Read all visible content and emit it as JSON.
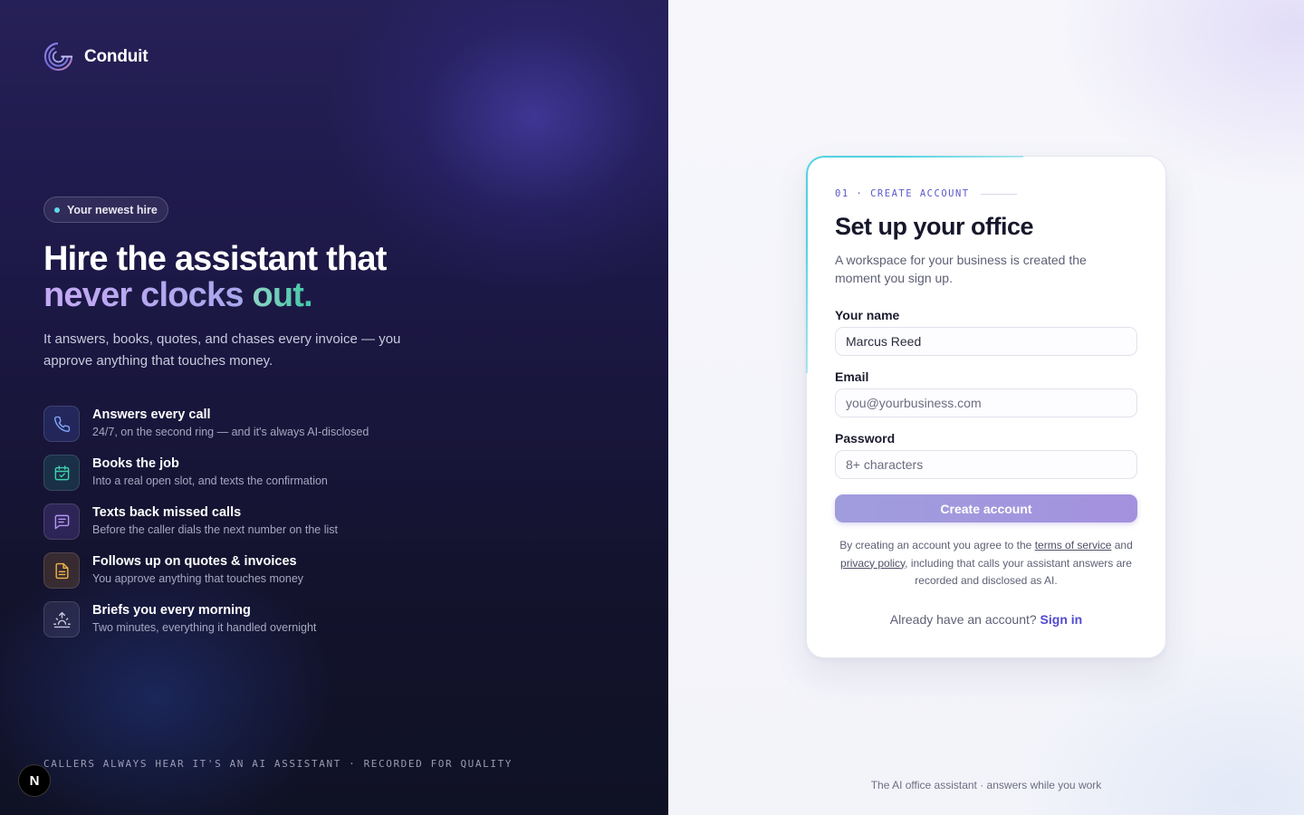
{
  "brand": {
    "name": "Conduit",
    "logo_icon": "conduit-logo-icon"
  },
  "hero": {
    "pill": "Your newest hire",
    "headline_line1": "Hire the assistant that",
    "headline_part_a": "never clocks",
    "headline_part_b": "out.",
    "subtitle": "It answers, books, quotes, and chases every invoice — you approve anything that touches money."
  },
  "features": [
    {
      "icon": "phone-icon",
      "title": "Answers every call",
      "desc": "24/7, on the second ring — and it's always AI-disclosed"
    },
    {
      "icon": "calendar-check-icon",
      "title": "Books the job",
      "desc": "Into a real open slot, and texts the confirmation"
    },
    {
      "icon": "message-icon",
      "title": "Texts back missed calls",
      "desc": "Before the caller dials the next number on the list"
    },
    {
      "icon": "document-icon",
      "title": "Follows up on quotes & invoices",
      "desc": "You approve anything that touches money"
    },
    {
      "icon": "sunrise-icon",
      "title": "Briefs you every morning",
      "desc": "Two minutes, everything it handled overnight"
    }
  ],
  "footnote": "CALLERS ALWAYS HEAR IT'S AN AI ASSISTANT · RECORDED FOR QUALITY",
  "badge": "N",
  "form": {
    "step": "01 · CREATE ACCOUNT",
    "title": "Set up your office",
    "subtitle": "A workspace for your business is created the moment you sign up.",
    "name_label": "Your name",
    "name_value": "Marcus Reed",
    "email_label": "Email",
    "email_placeholder": "you@yourbusiness.com",
    "password_label": "Password",
    "password_placeholder": "8+ characters",
    "submit": "Create account",
    "legal_prefix": "By creating an account you agree to the",
    "terms_link": "terms of service",
    "legal_and": "and",
    "privacy_link": "privacy policy",
    "legal_suffix": ", including that calls your assistant answers are recorded and disclosed as AI.",
    "signin_prompt": "Already have an account?",
    "signin_link": "Sign in"
  },
  "tagline": "The AI office assistant · answers while you work",
  "colors": {
    "accent": "#4f4ad0",
    "teal": "#5fd9e6",
    "button": "#a09ddd",
    "panel_dark": "#1c1846"
  }
}
